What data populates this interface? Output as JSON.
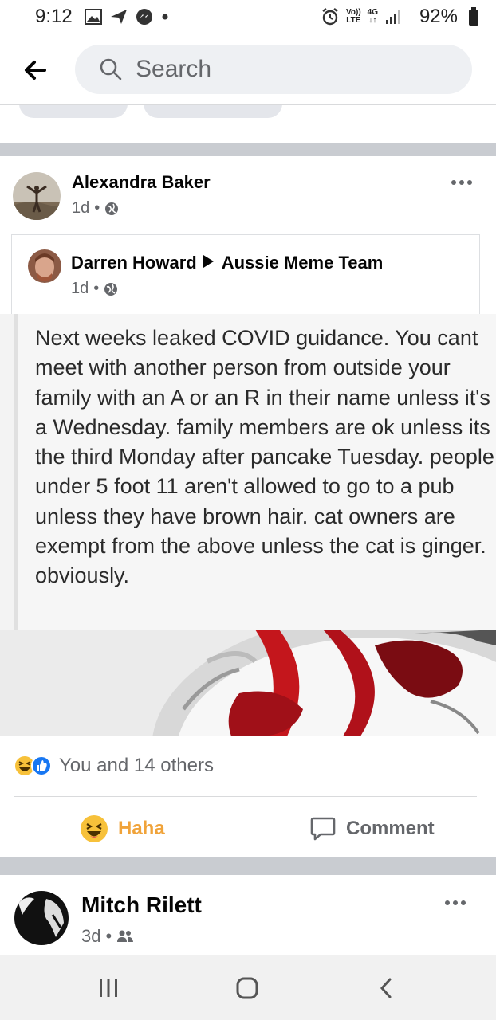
{
  "status_bar": {
    "time": "9:12",
    "lte_top": "Vo))",
    "lte_bottom": "LTE",
    "net_top": "4G",
    "net_bottom": "↓↑",
    "battery": "92%"
  },
  "search": {
    "placeholder": "Search"
  },
  "post": {
    "author": "Alexandra Baker",
    "time": "1d",
    "shared": {
      "author": "Darren Howard",
      "group": "Aussie Meme Team",
      "time": "1d"
    },
    "meme_text": "Next weeks leaked COVID guidance. You cant meet with another person from outside your family with an A or an R in their name unless it's a Wednesday. family members are ok unless its the third Monday after pancake Tuesday. people under 5 foot 11 aren't allowed to go to a pub unless they have brown hair. cat owners are exempt from the above unless the cat is ginger. obviously.",
    "reactions_text": "You and 14 others",
    "actions": {
      "haha": "Haha",
      "comment": "Comment"
    }
  },
  "post2": {
    "author": "Mitch Rilett",
    "time": "3d"
  },
  "colors": {
    "haha_orange": "#f0a33a",
    "like_blue": "#1877f2",
    "meta_gray": "#65676b"
  },
  "icons": [
    "back-arrow-icon",
    "search-icon",
    "globe-icon",
    "friends-icon",
    "more-icon",
    "comment-icon",
    "haha-emoji-icon",
    "like-icon"
  ]
}
